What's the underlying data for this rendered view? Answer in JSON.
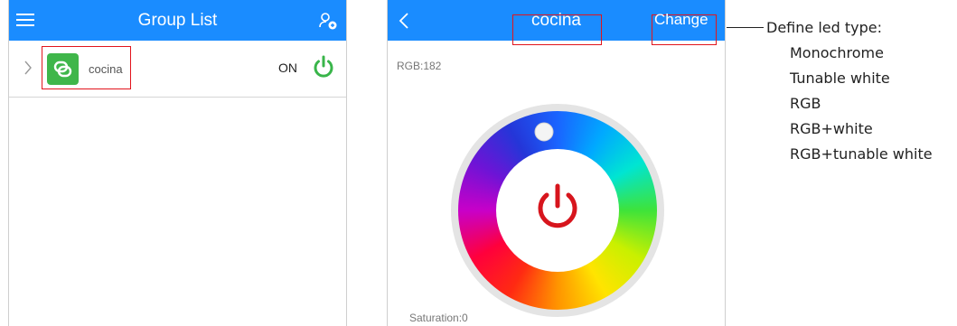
{
  "left": {
    "header": {
      "title": "Group List"
    },
    "groups": [
      {
        "name": "cocina",
        "state": "ON"
      }
    ]
  },
  "right": {
    "header": {
      "title": "cocina",
      "change_label": "Change"
    },
    "rgb_label": "RGB:182",
    "saturation_label": "Saturation:0"
  },
  "annotation": {
    "title": "Define led type:",
    "types": [
      "Monochrome",
      "Tunable white",
      "RGB",
      "RGB+white",
      "RGB+tunable white"
    ]
  },
  "colors": {
    "header_blue": "#1a8cff",
    "icon_green": "#3fb64a",
    "power_green": "#39b54a",
    "power_red": "#d7151d",
    "highlight_red": "#e2141c"
  }
}
